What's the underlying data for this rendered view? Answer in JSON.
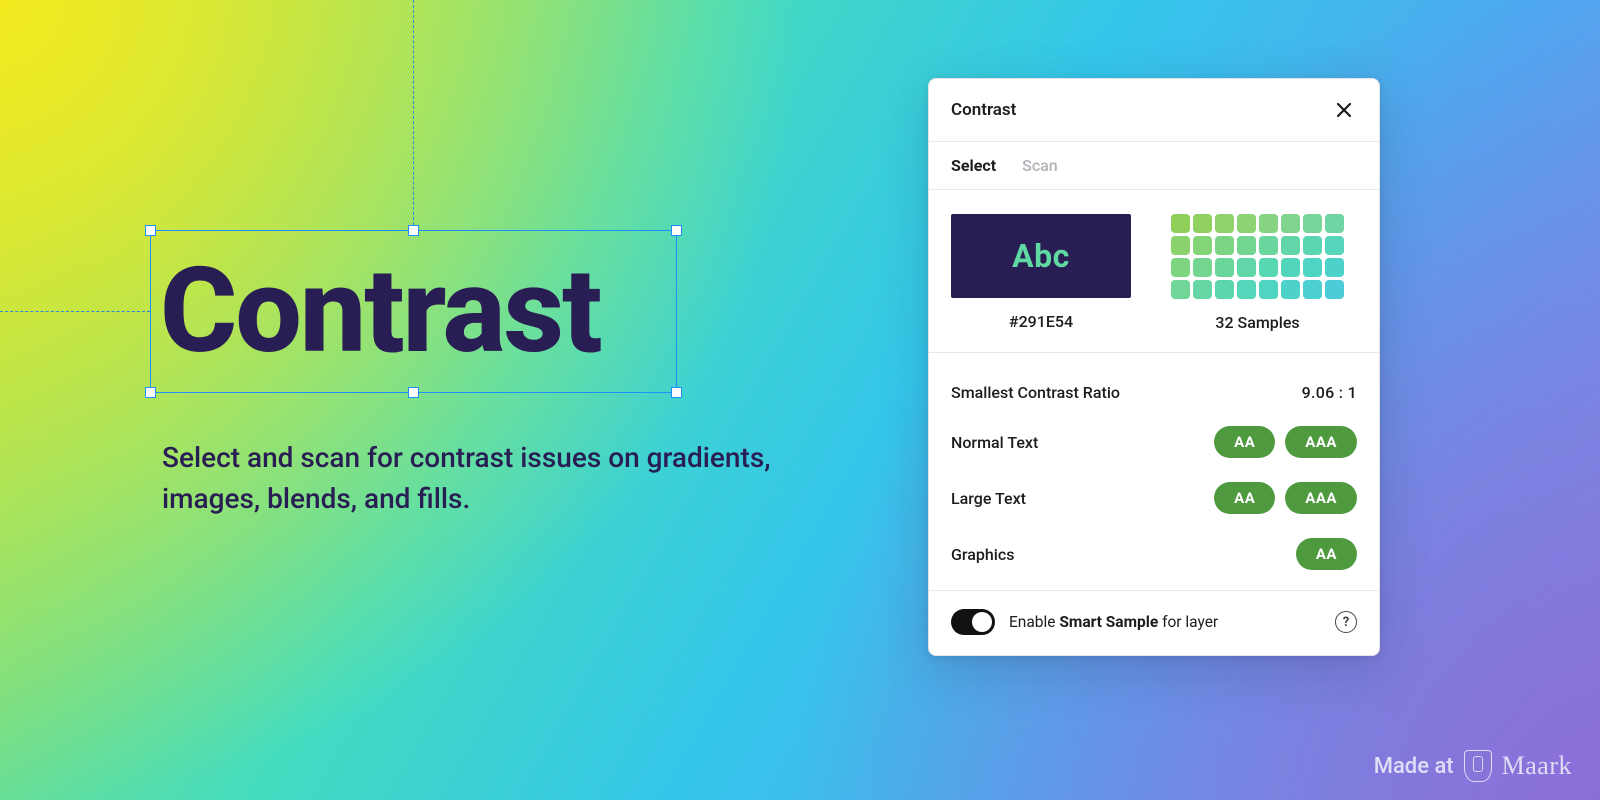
{
  "canvas": {
    "headline": "Contrast",
    "subhead": "Select and scan for contrast issues on gradients, images, blends, and fills."
  },
  "panel": {
    "title": "Contrast",
    "tabs": {
      "select": "Select",
      "scan": "Scan",
      "active": "select"
    },
    "swatch": {
      "sample_text": "Abc",
      "hex": "#291E54"
    },
    "samples": {
      "label": "32 Samples",
      "count": 32,
      "colors": [
        "#8fd05b",
        "#90d160",
        "#8fd26a",
        "#8cd374",
        "#86d481",
        "#7fd48e",
        "#77d59a",
        "#70d5a5",
        "#8ad36c",
        "#84d478",
        "#7cd585",
        "#73d592",
        "#6ad69e",
        "#62d6a9",
        "#5bd6b2",
        "#56d5bb",
        "#7dd582",
        "#74d58f",
        "#6ad69c",
        "#61d6a8",
        "#59d6b2",
        "#53d5bb",
        "#4fd4c3",
        "#4dd2ca",
        "#6fd698",
        "#65d6a4",
        "#5cd6af",
        "#55d5b9",
        "#50d4c2",
        "#4dd2ca",
        "#4bcfd1",
        "#4bccd8"
      ]
    },
    "metrics": {
      "ratio_label": "Smallest Contrast Ratio",
      "ratio_value": "9.06 : 1",
      "rows": [
        {
          "label": "Normal Text",
          "badges": [
            "AA",
            "AAA"
          ]
        },
        {
          "label": "Large Text",
          "badges": [
            "AA",
            "AAA"
          ]
        },
        {
          "label": "Graphics",
          "badges": [
            "AA"
          ]
        }
      ]
    },
    "footer": {
      "toggle_on": true,
      "label_pre": "Enable ",
      "label_strong": "Smart Sample",
      "label_post": " for layer"
    }
  },
  "attribution": {
    "prefix": "Made at",
    "brand": "Maark"
  }
}
